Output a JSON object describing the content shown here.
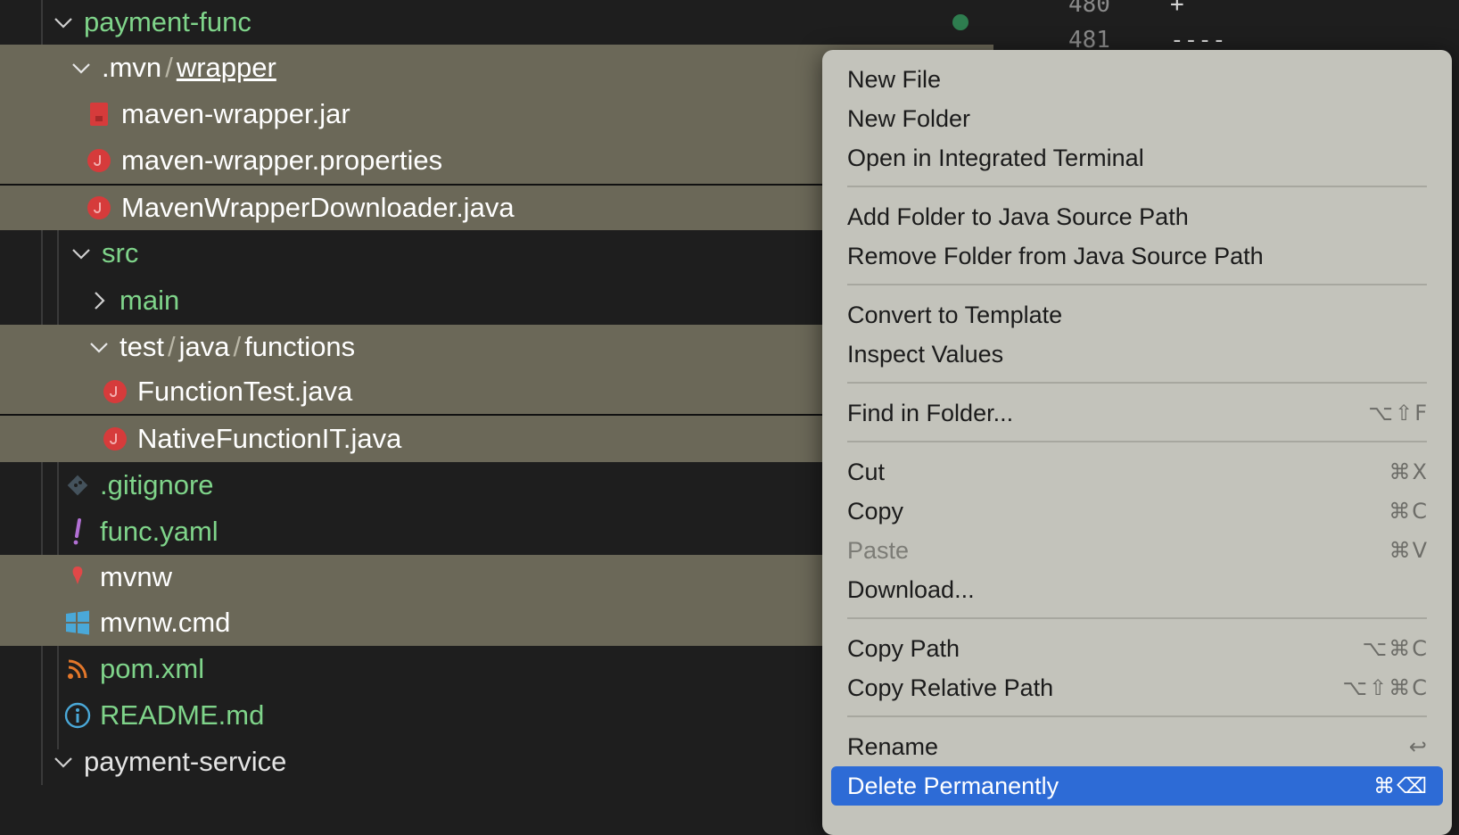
{
  "explorer": {
    "folder_payment_func": "payment-func",
    "mvn_folder": ".mvn",
    "wrapper_folder": "wrapper",
    "file_maven_wrapper_jar": "maven-wrapper.jar",
    "file_maven_wrapper_properties": "maven-wrapper.properties",
    "file_maven_wrapper_downloader": "MavenWrapperDownloader.java",
    "folder_src": "src",
    "folder_main": "main",
    "folder_test": "test",
    "folder_java": "java",
    "folder_functions": "functions",
    "file_function_test": "FunctionTest.java",
    "file_native_function_it": "NativeFunctionIT.java",
    "file_gitignore": ".gitignore",
    "file_func_yaml": "func.yaml",
    "file_mvnw": "mvnw",
    "file_mvnw_cmd": "mvnw.cmd",
    "file_pom": "pom.xml",
    "file_readme": "README.md",
    "folder_payment_service": "payment-service",
    "path_separator": "/"
  },
  "editor": {
    "lines": [
      {
        "number": "480",
        "text": "+"
      },
      {
        "number": "481",
        "text": "----"
      }
    ]
  },
  "context_menu": {
    "new_file": "New File",
    "new_folder": "New Folder",
    "open_terminal": "Open in Integrated Terminal",
    "add_folder_java": "Add Folder to Java Source Path",
    "remove_folder_java": "Remove Folder from Java Source Path",
    "convert_template": "Convert to Template",
    "inspect_values": "Inspect Values",
    "find_in_folder": "Find in Folder...",
    "find_in_folder_shortcut": "⌥⇧F",
    "cut": "Cut",
    "cut_shortcut": "⌘X",
    "copy": "Copy",
    "copy_shortcut": "⌘C",
    "paste": "Paste",
    "paste_shortcut": "⌘V",
    "download": "Download...",
    "copy_path": "Copy Path",
    "copy_path_shortcut": "⌥⌘C",
    "copy_relative_path": "Copy Relative Path",
    "copy_relative_path_shortcut": "⌥⇧⌘C",
    "rename": "Rename",
    "rename_shortcut": "↩",
    "delete_permanently": "Delete Permanently",
    "delete_permanently_shortcut": "⌘⌫"
  },
  "colors": {
    "selection_highlight": "#6b6858",
    "folder_text_green": "#7fd48a",
    "menu_background": "#c3c3bb",
    "menu_active": "#2d6bd6",
    "java_icon_red": "#d63b3b"
  },
  "icons": {
    "chevron_down": "chevron-down-icon",
    "chevron_right": "chevron-right-icon",
    "java": "java-icon",
    "jar": "jar-file-icon",
    "git": "git-icon",
    "yaml": "yaml-icon",
    "shell": "shell-icon",
    "windows": "windows-icon",
    "rss": "rss-icon",
    "info": "info-icon"
  }
}
